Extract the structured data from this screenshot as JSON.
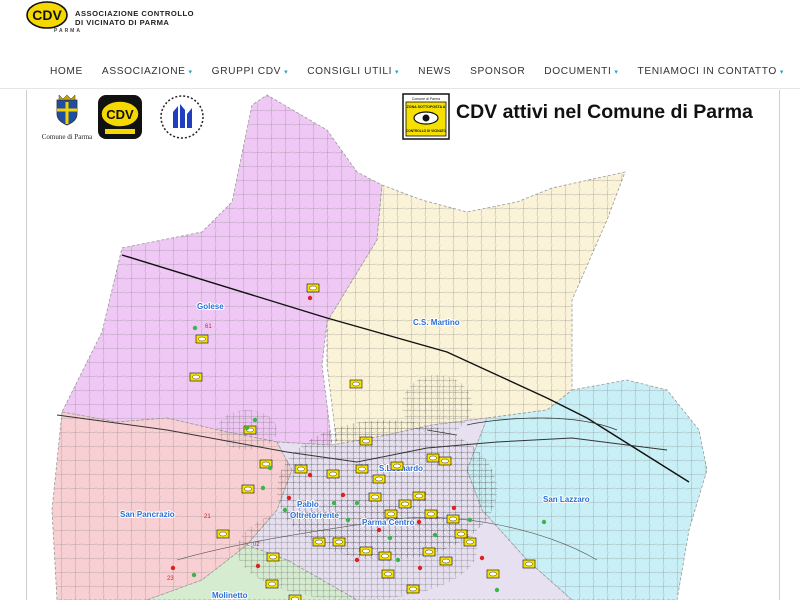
{
  "brand": {
    "badge_text": "CDV",
    "line1": "ASSOCIAZIONE CONTROLLO",
    "line2": "DI VICINATO DI PARMA",
    "sub": "PARMA"
  },
  "nav": {
    "items": [
      {
        "label": "HOME",
        "has_dropdown": false
      },
      {
        "label": "ASSOCIAZIONE",
        "has_dropdown": true
      },
      {
        "label": "GRUPPI CDV",
        "has_dropdown": true
      },
      {
        "label": "CONSIGLI UTILI",
        "has_dropdown": true
      },
      {
        "label": "NEWS",
        "has_dropdown": false
      },
      {
        "label": "SPONSOR",
        "has_dropdown": false
      },
      {
        "label": "DOCUMENTI",
        "has_dropdown": true
      },
      {
        "label": "TENIAMOCI IN CONTATTO",
        "has_dropdown": true
      }
    ],
    "caret": "▾"
  },
  "map": {
    "title": "CDV attivi nel Comune di Parma",
    "comune_label": "Comune di Parma",
    "zona_sign": {
      "top": "Comune di Parma",
      "mid": "ZONA SOTTOPOSTA A",
      "bottom": "CONTROLLO DI VICINATO"
    },
    "districts": [
      {
        "name": "Golese",
        "color": "#f0c8f5"
      },
      {
        "name": "C.S. Martino",
        "color": "#fbf3d8"
      },
      {
        "name": "S.Leonardo",
        "color": "#e6e0f0"
      },
      {
        "name": "San Lazzaro",
        "color": "#c9f0f6"
      },
      {
        "name": "San Pancrazio",
        "color": "#f8cfd2"
      },
      {
        "name": "Pablo",
        "color": "#e6e0f0"
      },
      {
        "name": "Oltretorrente",
        "color": "#e6e0f0"
      },
      {
        "name": "Parma Centro",
        "color": "#e6e0f0"
      },
      {
        "name": "Molinetto",
        "color": "#d6ecd0"
      }
    ],
    "marker_numbers": [
      "61",
      "21",
      "23",
      "02"
    ],
    "colors": {
      "label_blue": "#2a6fd6",
      "marker_yellow": "#f7e000",
      "marker_green": "#3ab54a",
      "marker_red": "#e02020"
    }
  }
}
